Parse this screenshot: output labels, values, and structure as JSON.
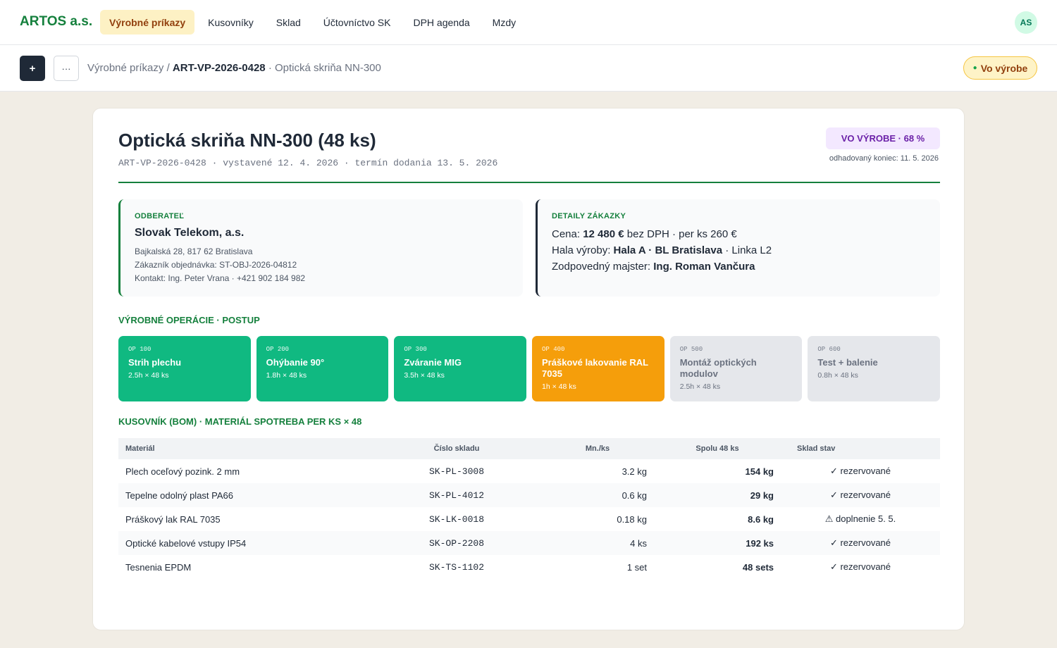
{
  "nav": {
    "brand": "ARTOS a.s.",
    "tabs": [
      {
        "label": "Výrobné príkazy",
        "active": true
      },
      {
        "label": "Kusovníky"
      },
      {
        "label": "Sklad"
      },
      {
        "label": "Účtovníctvo SK"
      },
      {
        "label": "DPH agenda"
      },
      {
        "label": "Mzdy"
      }
    ],
    "avatar": "AS"
  },
  "toolbar": {
    "add_label": "+",
    "more_label": "···",
    "breadcrumb_root": "Výrobné príkazy",
    "breadcrumb_sep": "/",
    "breadcrumb_current": "ART-VP-2026-0428",
    "breadcrumb_suffix": "· Optická skriňa NN-300",
    "status_label": "Vo výrobe"
  },
  "order": {
    "title": "Optická skriňa NN-300 (48 ks)",
    "meta": "ART-VP-2026-0428 · vystavené 12. 4. 2026 · termín dodania 13. 5. 2026",
    "progress_label": "VO VÝROBE · 68 %",
    "progress_percent": 68,
    "eta": "odhadovaný koniec: 11. 5. 2026"
  },
  "customer": {
    "heading": "ODBERATEĽ",
    "name": "Slovak Telekom, a.s.",
    "address": "Bajkalská 28, 817 62 Bratislava",
    "order_ref": "Zákazník objednávka: ST-OBJ-2026-04812",
    "contact": "Kontakt: Ing. Peter Vrana · +421 902 184 982"
  },
  "details": {
    "heading": "DETAILY ZÁKAZKY",
    "price_prefix": "Cena:",
    "price_value": "12 480 €",
    "price_suffix": "bez DPH · per ks 260 €",
    "hall_prefix": "Hala výroby:",
    "hall_value": "Hala A · BL Bratislava",
    "hall_suffix": "· Linka L2",
    "foreman_prefix": "Zodpovedný majster:",
    "foreman_value": "Ing. Roman Vančura"
  },
  "operations": {
    "heading": "VÝROBNÉ OPERÁCIE · POSTUP",
    "items": [
      {
        "code": "OP 100",
        "name": "Strih plechu",
        "time": "2.5h × 48 ks",
        "state": "done"
      },
      {
        "code": "OP 200",
        "name": "Ohýbanie 90°",
        "time": "1.8h × 48 ks",
        "state": "done"
      },
      {
        "code": "OP 300",
        "name": "Zváranie MIG",
        "time": "3.5h × 48 ks",
        "state": "done"
      },
      {
        "code": "OP 400",
        "name": "Práškové lakovanie RAL 7035",
        "time": "1h × 48 ks",
        "state": "active"
      },
      {
        "code": "OP 500",
        "name": "Montáž optických modulov",
        "time": "2.5h × 48 ks",
        "state": "pending"
      },
      {
        "code": "OP 600",
        "name": "Test + balenie",
        "time": "0.8h × 48 ks",
        "state": "pending"
      }
    ]
  },
  "bom": {
    "heading": "KUSOVNÍK (BOM) · MATERIÁL SPOTREBA PER KS × 48",
    "columns": [
      "Materiál",
      "Číslo skladu",
      "Mn./ks",
      "Spolu 48 ks",
      "Sklad stav"
    ],
    "rows": [
      {
        "material": "Plech oceľový pozink. 2 mm",
        "sku": "SK-PL-3008",
        "per_unit": "3.2 kg",
        "total": "154 kg",
        "status": "✓ rezervované",
        "ok": true
      },
      {
        "material": "Tepelne odolný plast PA66",
        "sku": "SK-PL-4012",
        "per_unit": "0.6 kg",
        "total": "29 kg",
        "status": "✓ rezervované",
        "ok": true
      },
      {
        "material": "Práškový lak RAL 7035",
        "sku": "SK-LK-0018",
        "per_unit": "0.18 kg",
        "total": "8.6 kg",
        "status": "⚠ doplnenie 5. 5.",
        "ok": false
      },
      {
        "material": "Optické kabelové vstupy IP54",
        "sku": "SK-OP-2208",
        "per_unit": "4 ks",
        "total": "192 ks",
        "status": "✓ rezervované",
        "ok": true
      },
      {
        "material": "Tesnenia EPDM",
        "sku": "SK-TS-1102",
        "per_unit": "1 set",
        "total": "48 sets",
        "status": "✓ rezervované",
        "ok": true
      }
    ]
  },
  "colors": {
    "brand": "#15803d",
    "done": "#10b981",
    "active": "#f59e0b",
    "pending": "#e5e7eb"
  }
}
